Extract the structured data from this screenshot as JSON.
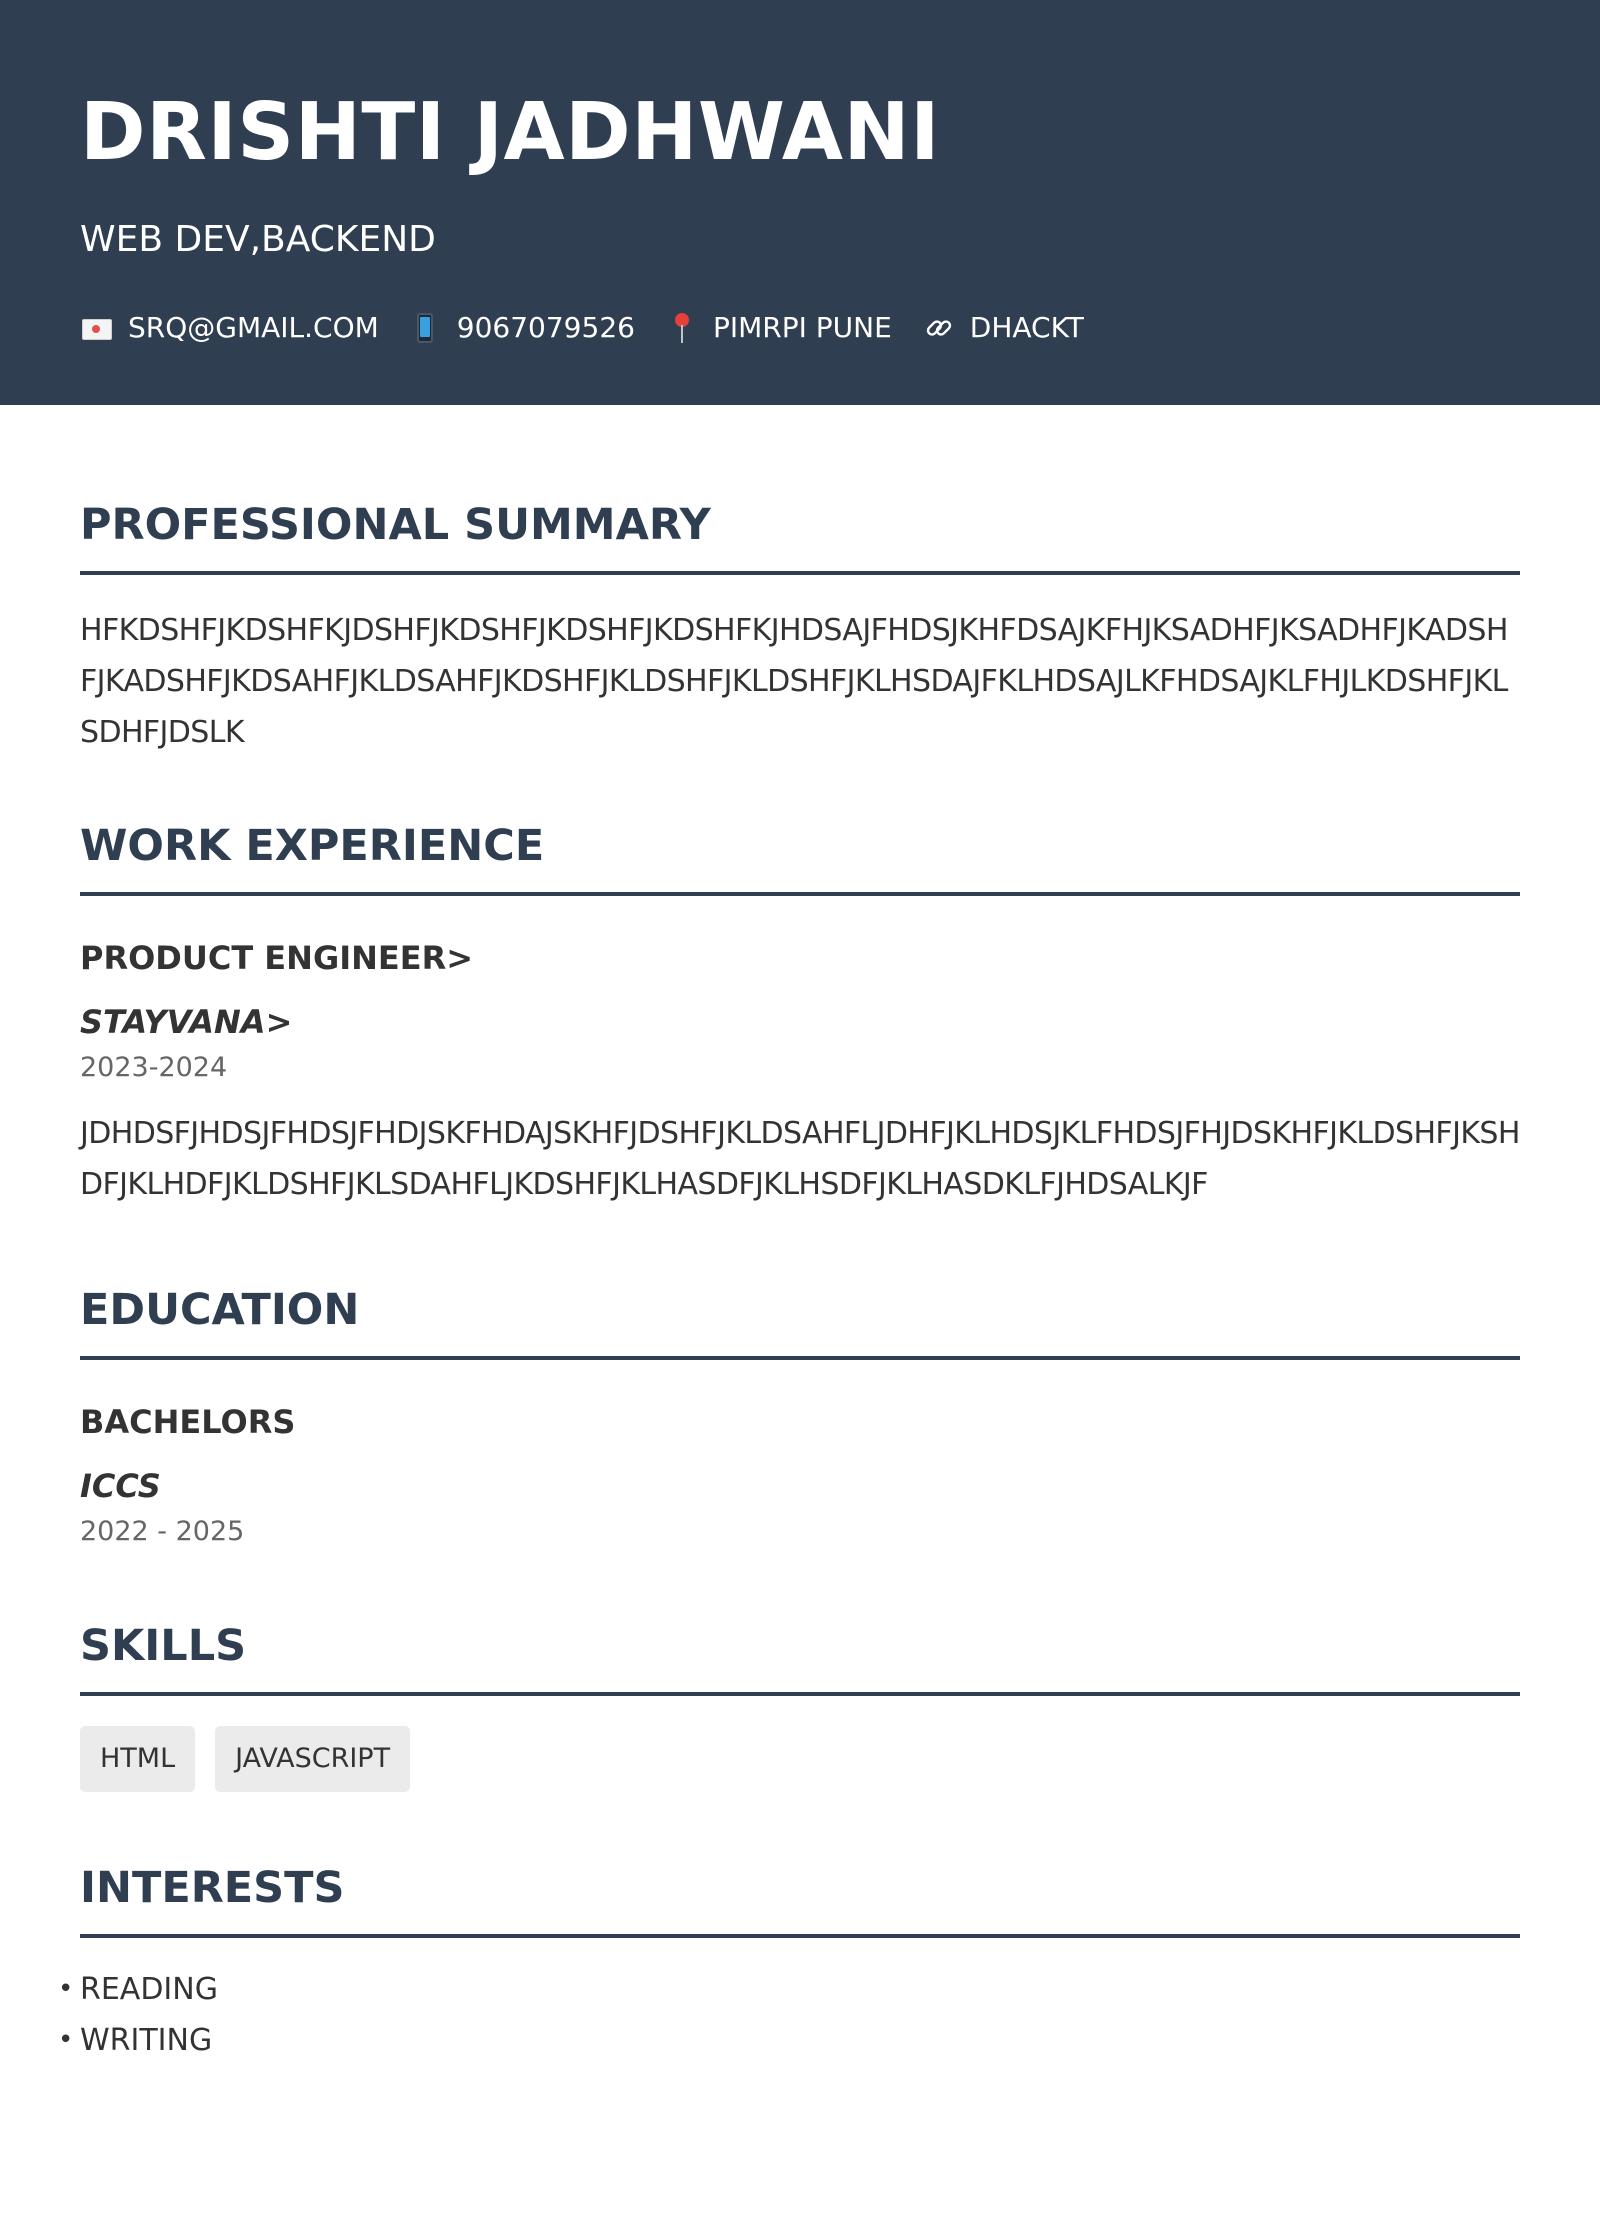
{
  "header": {
    "name": "DRISHTI JADHWANI",
    "headline": "WEB DEV,BACKEND",
    "contacts": [
      {
        "icon": "envelope-icon",
        "text": "SRQ@GMAIL.COM"
      },
      {
        "icon": "mobile-phone-icon",
        "text": "9067079526"
      },
      {
        "icon": "location-pin-icon",
        "text": "PIMRPI PUNE"
      },
      {
        "icon": "link-icon",
        "text": "DHACKT"
      }
    ],
    "background_color": "#2f3e51"
  },
  "summary": {
    "title": "PROFESSIONAL SUMMARY",
    "text": "HFKDSHFJKDSHFKJDSHFJKDSHFJKDSHFJKDSHFKJHDSAJFHDSJKHFDSAJKFHJKSADHFJKSADHFJKADSHFJKADSHFJKDSAHFJKLDSAHFJKDSHFJKLDSHFJKLDSHFJKLHSDAJFKLHDSAJLKFHDSAJKLFHJLKDSHFJKLSDHFJDSLK"
  },
  "experience": {
    "title": "WORK EXPERIENCE",
    "items": [
      {
        "role": "PRODUCT ENGINEER>",
        "company": "STAYVANA>",
        "dates": "2023-2024",
        "description": "JDHDSFJHDSJFHDSJFHDJSKFHDAJSKHFJDSHFJKLDSAHFLJDHFJKLHDSJKLFHDSJFHJDSKHFJKLDSHFJKSHDFJKLHDFJKLDSHFJKLSDAHFLJKDSHFJKLHASDFJKLHSDFJKLHASDKLFJHDSALKJF"
      }
    ]
  },
  "education": {
    "title": "EDUCATION",
    "items": [
      {
        "degree": "BACHELORS",
        "school": "ICCS",
        "dates": "2022 - 2025"
      }
    ]
  },
  "skills": {
    "title": "SKILLS",
    "items": [
      "HTML",
      "JAVASCRIPT"
    ]
  },
  "interests": {
    "title": "INTERESTS",
    "items": [
      "READING",
      "WRITING"
    ]
  },
  "colors": {
    "accent": "#2f3e51",
    "text": "#333333",
    "muted": "#666666",
    "chip": "#ebebeb"
  }
}
